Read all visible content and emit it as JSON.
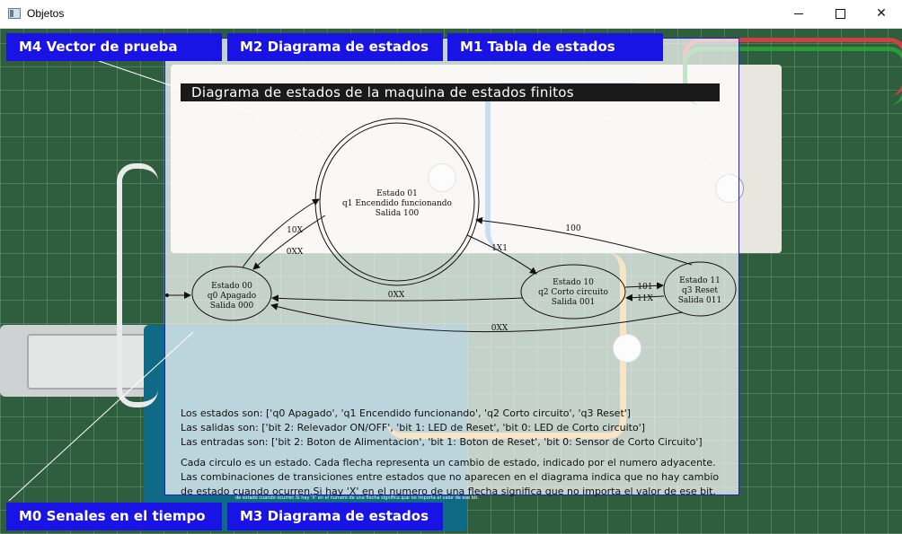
{
  "window": {
    "title": "Objetos",
    "minimize": "—",
    "maximize": "☐",
    "close": "✕"
  },
  "menu_buttons": {
    "m4": "M4  Vector de prueba",
    "m2": "M2  Diagrama de estados",
    "m1": "M1  Tabla de estados",
    "m0": "M0  Senales en el tiempo",
    "m3": "M3  Diagrama de estados"
  },
  "diagram": {
    "title": "Diagrama de estados de la maquina de estados finitos",
    "states": [
      {
        "id": "s01",
        "lines": [
          "Estado 01",
          "q1 Encendido funcionando",
          "Salida 100"
        ]
      },
      {
        "id": "s00",
        "lines": [
          "Estado 00",
          "q0 Apagado",
          "Salida 000"
        ]
      },
      {
        "id": "s10",
        "lines": [
          "Estado 10",
          "q2 Corto circuito",
          "Salida 001"
        ]
      },
      {
        "id": "s11",
        "lines": [
          "Estado 11",
          "q3 Reset",
          "Salida 011"
        ]
      }
    ],
    "transitions": [
      "10X",
      "0XX",
      "1X1",
      "100",
      "0XX",
      "101",
      "11X",
      "0XX"
    ]
  },
  "info": {
    "states_line": "Los estados son: ['q0 Apagado', 'q1 Encendido funcionando', 'q2 Corto circuito', 'q3 Reset']",
    "outputs_line": "Las salidas son: ['bit 2: Relevador ON/OFF', 'bit 1: LED de Reset', 'bit 0: LED de Corto circuito']",
    "inputs_line": "Las entradas son: ['bit 2: Boton de Alimentacion', 'bit 1: Boton de Reset', 'bit 0: Sensor de Corto Circuito']",
    "desc1": "Cada circulo es un estado. Cada flecha representa un cambio de estado, indicado por el numero adyacente.",
    "desc2": "Las combinaciones de transiciones entre estados que no aparecen en el diagrama indica que no hay cambio",
    "desc3": "de estado cuando ocurren.Si hay 'X' en el numero de una flecha significa que no importa el valor de ese bit.",
    "tiny_caption": "de estado cuando ocurren.Si hay 'X' en el numero de una flecha significa que no importa el valor de ese bit."
  },
  "colors": {
    "accent": "#1a13e6",
    "overlay_border": "#1a22c8",
    "board": "#2f5e3e"
  }
}
